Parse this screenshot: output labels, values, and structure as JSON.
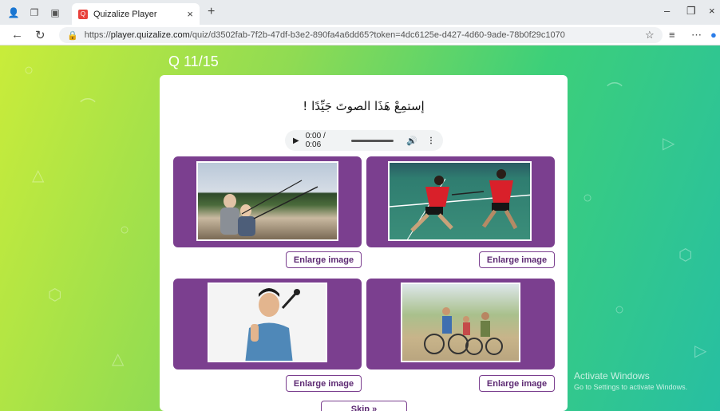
{
  "browser": {
    "tab_title": "Quizalize Player",
    "url_prefix": "https://",
    "url_host": "player.quizalize.com",
    "url_path": "/quiz/d3502fab-7f2b-47df-b3e2-890fa4a6dd65?token=4dc6125e-d427-4d60-9ade-78b0f29c1070"
  },
  "quiz": {
    "progress_label": "Q 11/15",
    "question": "إستمِعْ هَذَا الصوتَ جَيِّدًا !",
    "audio_time": "0:00 / 0:06",
    "options": [
      {
        "enlarge_label": "Enlarge image",
        "picture": "man and boy fishing at a lake"
      },
      {
        "enlarge_label": "Enlarge image",
        "picture": "badminton doubles players"
      },
      {
        "enlarge_label": "Enlarge image",
        "picture": "man singing into a microphone"
      },
      {
        "enlarge_label": "Enlarge image",
        "picture": "family riding bicycles"
      }
    ],
    "skip_label": "Skip »"
  },
  "watermark": {
    "title": "Activate Windows",
    "subtitle": "Go to Settings to activate Windows."
  },
  "colors": {
    "accent": "#7b3f8f",
    "bg_start": "#c9ec3a",
    "bg_end": "#27bfa2"
  }
}
